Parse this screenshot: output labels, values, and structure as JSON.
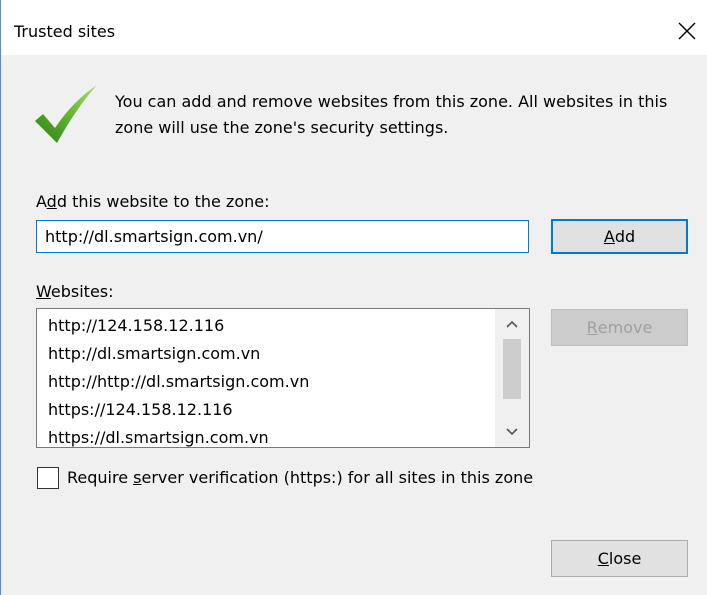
{
  "window": {
    "title": "Trusted sites",
    "close_icon": "close-icon"
  },
  "info": {
    "icon": "checkmark-icon",
    "text": "You can add and remove websites from this zone. All websites in this zone will use the zone's security settings."
  },
  "add_section": {
    "label_pre": "A",
    "label_accel": "d",
    "label_post": "d this website to the zone:",
    "input_value": "http://dl.smartsign.com.vn/",
    "add_button_accel": "A",
    "add_button_rest": "dd"
  },
  "websites": {
    "label_accel": "W",
    "label_rest": "ebsites:",
    "items": [
      "http://124.158.12.116",
      "http://dl.smartsign.com.vn",
      "http://http://dl.smartsign.com.vn",
      "https://124.158.12.116",
      "https://dl.smartsign.com.vn"
    ],
    "remove_button_accel": "R",
    "remove_button_rest": "emove"
  },
  "require_verification": {
    "checked": false,
    "label_pre": "Require ",
    "label_accel": "s",
    "label_post": "erver verification (https:) for all sites in this zone"
  },
  "footer": {
    "close_button_accel": "C",
    "close_button_rest": "lose"
  },
  "colors": {
    "accent": "#0078d7",
    "checkmark_dark": "#3d8b1f",
    "checkmark_light": "#8ad24a"
  }
}
